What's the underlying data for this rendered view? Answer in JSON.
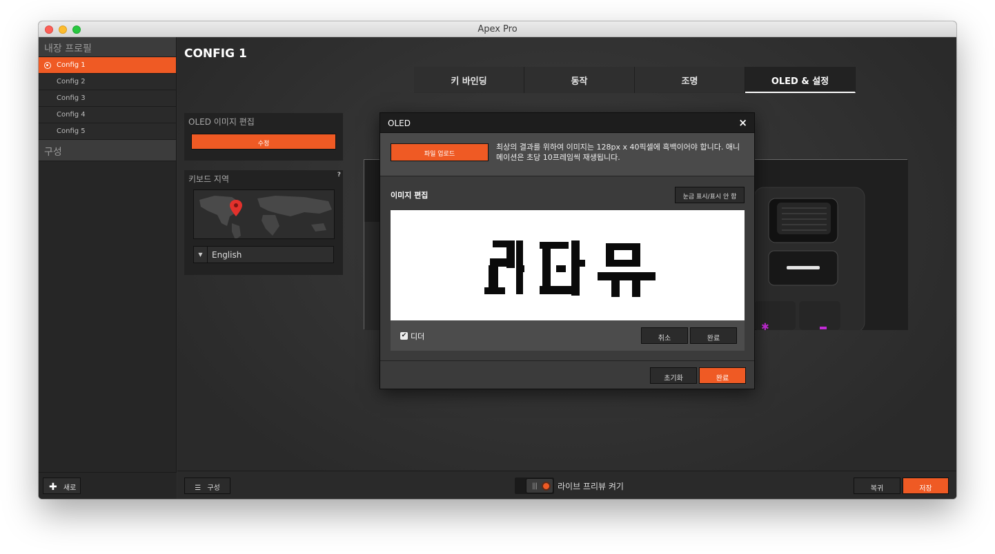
{
  "window": {
    "title": "Apex Pro"
  },
  "sidebar": {
    "header": "내장 프로필",
    "configs": [
      "Config 1",
      "Config 2",
      "Config 3",
      "Config 4",
      "Config 5"
    ],
    "section2": "구성",
    "new_button": "새로"
  },
  "main": {
    "config_title": "CONFIG 1",
    "tabs": [
      "키 바인딩",
      "동작",
      "조명",
      "OLED & 설정"
    ],
    "oled_panel": {
      "title": "OLED 이미지 편집",
      "edit_button": "수정"
    },
    "region_panel": {
      "title": "키보드 지역",
      "help": "?",
      "language": "English"
    }
  },
  "bottom": {
    "config_button": "구성",
    "live_preview": "라이브 프리뷰 켜기",
    "revert_button": "복귀",
    "save_button": "저장"
  },
  "modal": {
    "title": "OLED",
    "close": "×",
    "upload_button": "파일 업로드",
    "upload_note": "최상의 결과를 위하여 이미지는 128px x 40픽셀에 흑백이어야 합니다. 애니메이션은 초당 10프레임씩 재생됩니다.",
    "edit_title": "이미지 편집",
    "grid_button": "눈금 표시/표시 안 함",
    "dither_label": "디더",
    "cancel_button": "취소",
    "done_inner_button": "완료",
    "reset_button": "초기화",
    "done_button": "완료"
  },
  "colors": {
    "accent": "#ef5a24",
    "background": "#2e2e2e"
  }
}
